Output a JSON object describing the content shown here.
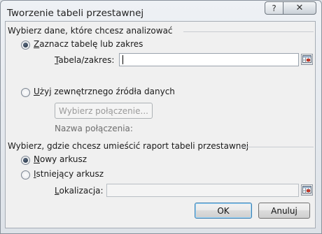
{
  "dialog": {
    "title": "Tworzenie tabeli przestawnej",
    "help_glyph": "?",
    "close_glyph": "✕"
  },
  "data_source": {
    "heading": "Wybierz dane, które chcesz analizować",
    "option_table": {
      "accesskey": "Z",
      "rest": "aznacz tabelę lub zakres",
      "selected": true
    },
    "table_range": {
      "accesskey": "T",
      "rest": "abela/zakres:",
      "value": ""
    },
    "option_external": {
      "accesskey": "U",
      "rest": "żyj zewnętrznego źródła danych",
      "selected": false
    },
    "choose_connection_label": "Wybierz połączenie...",
    "connection_name_label": "Nazwa połączenia:"
  },
  "placement": {
    "heading": "Wybierz, gdzie chcesz umieścić raport tabeli przestawnej",
    "option_new": {
      "accesskey": "N",
      "rest": "owy arkusz",
      "selected": true
    },
    "option_existing": {
      "accesskey": "I",
      "rest": "stniejący arkusz",
      "selected": false
    },
    "location": {
      "accesskey": "L",
      "rest": "okalizacja:",
      "value": ""
    }
  },
  "buttons": {
    "ok": "OK",
    "cancel": "Anuluj"
  },
  "icons": {
    "range_picker": "range-picker-icon",
    "help": "help-icon",
    "close": "close-icon"
  }
}
